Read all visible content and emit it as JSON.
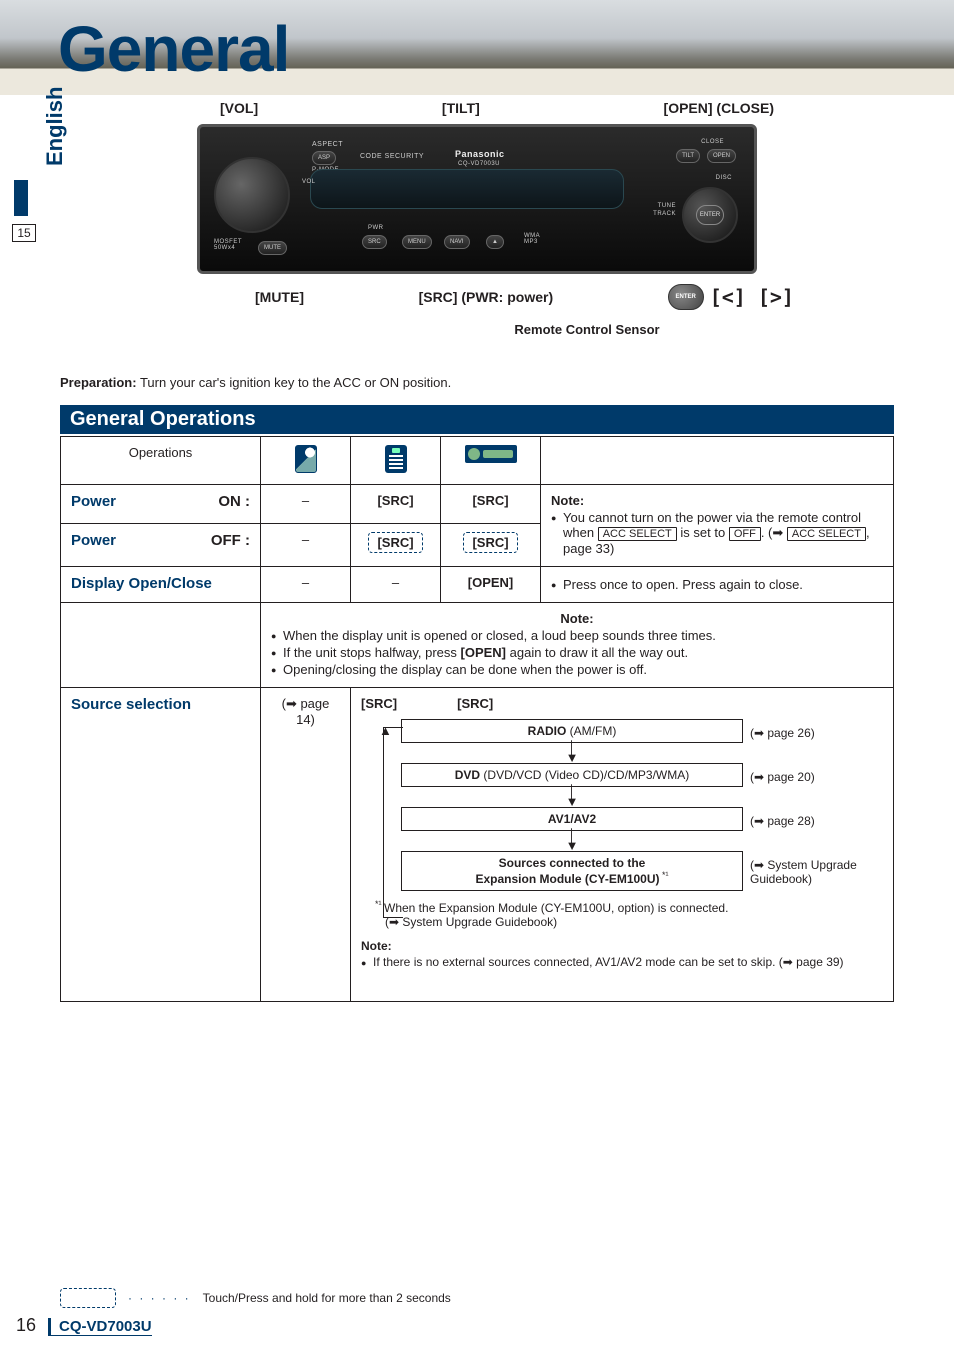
{
  "page": {
    "title": "General",
    "language_tab": "English",
    "side_page_box": "15",
    "footer_page": "16",
    "footer_model": "CQ-VD7003U"
  },
  "diagram": {
    "top_labels": {
      "vol": "[VOL]",
      "tilt": "[TILT]",
      "open_close": "[OPEN] (CLOSE)"
    },
    "faceplate": {
      "aspect": "ASPECT",
      "asp": "ASP",
      "pmode": "P·MODE",
      "code_security": "CODE SECURITY",
      "brand": "Panasonic",
      "model": "CQ-VD7003U",
      "close": "CLOSE",
      "tilt_btn": "TILT",
      "open_btn": "OPEN",
      "disc": "DISC",
      "tune": "TUNE",
      "track": "TRACK",
      "enter": "ENTER",
      "vol": "VOL",
      "mosfet": "MOSFET\n50Wx4",
      "mute": "MUTE",
      "pwr": "PWR",
      "src": "SRC",
      "menu": "MENU",
      "navi": "NAVI",
      "eject": "▲",
      "wma_mp3": "WMA\nMP3"
    },
    "bottom_labels": {
      "mute": "[MUTE]",
      "src_pwr": "[SRC] (PWR: power)",
      "enter_icon": "ENTER",
      "nav_brackets": "[<] [>]"
    },
    "remote_sensor": "Remote Control Sensor"
  },
  "preparation": {
    "label": "Preparation:",
    "text": " Turn your car's ignition key to the ACC or ON position."
  },
  "section_title": "General Operations",
  "table": {
    "header_operations": "Operations",
    "rows": {
      "power_on": {
        "label": "Power",
        "sub": "ON :",
        "a": "–",
        "b": "[SRC]",
        "c": "[SRC]"
      },
      "power_off": {
        "label": "Power",
        "sub": "OFF :",
        "a": "–",
        "b": "[SRC]",
        "c": "[SRC]"
      },
      "power_note": {
        "title": "Note:",
        "bullet1_a": "You cannot turn on the power via the remote control when ",
        "bullet1_key1": "ACC SELECT",
        "bullet1_b": " is set to ",
        "bullet1_key2": "OFF",
        "bullet1_c": ". (➡ ",
        "bullet1_key3": "ACC SELECT",
        "bullet1_d": ", page 33)"
      },
      "display": {
        "label": "Display Open/Close",
        "a": "–",
        "b": "–",
        "c": "[OPEN]",
        "note_right": "Press once to open. Press again to close."
      },
      "display_note": {
        "title": "Note:",
        "b1": "When the display unit is opened or closed, a loud beep sounds three times.",
        "b2a": "If the unit stops halfway, press ",
        "b2b": "[OPEN]",
        "b2c": " again to draw it all the way out.",
        "b3": "Opening/closing the display can be done when the power is off."
      },
      "source": {
        "label": "Source selection",
        "a": "(➡ page 14)",
        "b": "[SRC]",
        "c": "[SRC]",
        "flow": {
          "radio_label": "RADIO",
          "radio_sub": " (AM/FM)",
          "radio_ref": "(➡ page 26)",
          "dvd_label": "DVD",
          "dvd_sub": " (DVD/VCD (Video CD)/CD/MP3/WMA)",
          "dvd_ref": "(➡ page 20)",
          "av_label": "AV1/AV2",
          "av_ref": "(➡ page 28)",
          "exp_line1": "Sources connected to the",
          "exp_line2": "Expansion Module (CY-EM100U)",
          "exp_ast": " *¹",
          "exp_ref": "(➡ System Upgrade Guidebook)"
        },
        "footnote_ast": "*¹ ",
        "footnote1": "When the Expansion Module (CY-EM100U, option) is connected.",
        "footnote2": "(➡ System Upgrade Guidebook)",
        "note_title": "Note:",
        "note_body_a": "If there is no external sources connected, AV1/AV2 mode can be set to skip. (➡ page 39)"
      }
    }
  },
  "legend": {
    "dots": "· · · · · ·",
    "text": "Touch/Press and hold for more than 2 seconds"
  }
}
